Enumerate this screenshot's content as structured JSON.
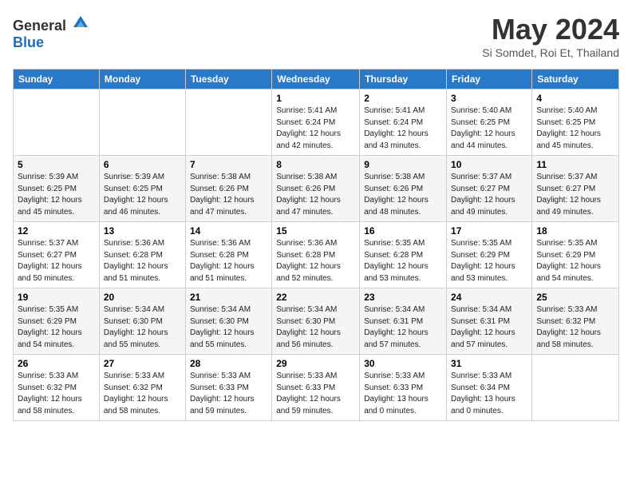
{
  "header": {
    "logo_general": "General",
    "logo_blue": "Blue",
    "month_title": "May 2024",
    "location": "Si Somdet, Roi Et, Thailand"
  },
  "weekdays": [
    "Sunday",
    "Monday",
    "Tuesday",
    "Wednesday",
    "Thursday",
    "Friday",
    "Saturday"
  ],
  "weeks": [
    [
      {
        "day": "",
        "info": ""
      },
      {
        "day": "",
        "info": ""
      },
      {
        "day": "",
        "info": ""
      },
      {
        "day": "1",
        "info": "Sunrise: 5:41 AM\nSunset: 6:24 PM\nDaylight: 12 hours\nand 42 minutes."
      },
      {
        "day": "2",
        "info": "Sunrise: 5:41 AM\nSunset: 6:24 PM\nDaylight: 12 hours\nand 43 minutes."
      },
      {
        "day": "3",
        "info": "Sunrise: 5:40 AM\nSunset: 6:25 PM\nDaylight: 12 hours\nand 44 minutes."
      },
      {
        "day": "4",
        "info": "Sunrise: 5:40 AM\nSunset: 6:25 PM\nDaylight: 12 hours\nand 45 minutes."
      }
    ],
    [
      {
        "day": "5",
        "info": "Sunrise: 5:39 AM\nSunset: 6:25 PM\nDaylight: 12 hours\nand 45 minutes."
      },
      {
        "day": "6",
        "info": "Sunrise: 5:39 AM\nSunset: 6:25 PM\nDaylight: 12 hours\nand 46 minutes."
      },
      {
        "day": "7",
        "info": "Sunrise: 5:38 AM\nSunset: 6:26 PM\nDaylight: 12 hours\nand 47 minutes."
      },
      {
        "day": "8",
        "info": "Sunrise: 5:38 AM\nSunset: 6:26 PM\nDaylight: 12 hours\nand 47 minutes."
      },
      {
        "day": "9",
        "info": "Sunrise: 5:38 AM\nSunset: 6:26 PM\nDaylight: 12 hours\nand 48 minutes."
      },
      {
        "day": "10",
        "info": "Sunrise: 5:37 AM\nSunset: 6:27 PM\nDaylight: 12 hours\nand 49 minutes."
      },
      {
        "day": "11",
        "info": "Sunrise: 5:37 AM\nSunset: 6:27 PM\nDaylight: 12 hours\nand 49 minutes."
      }
    ],
    [
      {
        "day": "12",
        "info": "Sunrise: 5:37 AM\nSunset: 6:27 PM\nDaylight: 12 hours\nand 50 minutes."
      },
      {
        "day": "13",
        "info": "Sunrise: 5:36 AM\nSunset: 6:28 PM\nDaylight: 12 hours\nand 51 minutes."
      },
      {
        "day": "14",
        "info": "Sunrise: 5:36 AM\nSunset: 6:28 PM\nDaylight: 12 hours\nand 51 minutes."
      },
      {
        "day": "15",
        "info": "Sunrise: 5:36 AM\nSunset: 6:28 PM\nDaylight: 12 hours\nand 52 minutes."
      },
      {
        "day": "16",
        "info": "Sunrise: 5:35 AM\nSunset: 6:28 PM\nDaylight: 12 hours\nand 53 minutes."
      },
      {
        "day": "17",
        "info": "Sunrise: 5:35 AM\nSunset: 6:29 PM\nDaylight: 12 hours\nand 53 minutes."
      },
      {
        "day": "18",
        "info": "Sunrise: 5:35 AM\nSunset: 6:29 PM\nDaylight: 12 hours\nand 54 minutes."
      }
    ],
    [
      {
        "day": "19",
        "info": "Sunrise: 5:35 AM\nSunset: 6:29 PM\nDaylight: 12 hours\nand 54 minutes."
      },
      {
        "day": "20",
        "info": "Sunrise: 5:34 AM\nSunset: 6:30 PM\nDaylight: 12 hours\nand 55 minutes."
      },
      {
        "day": "21",
        "info": "Sunrise: 5:34 AM\nSunset: 6:30 PM\nDaylight: 12 hours\nand 55 minutes."
      },
      {
        "day": "22",
        "info": "Sunrise: 5:34 AM\nSunset: 6:30 PM\nDaylight: 12 hours\nand 56 minutes."
      },
      {
        "day": "23",
        "info": "Sunrise: 5:34 AM\nSunset: 6:31 PM\nDaylight: 12 hours\nand 57 minutes."
      },
      {
        "day": "24",
        "info": "Sunrise: 5:34 AM\nSunset: 6:31 PM\nDaylight: 12 hours\nand 57 minutes."
      },
      {
        "day": "25",
        "info": "Sunrise: 5:33 AM\nSunset: 6:32 PM\nDaylight: 12 hours\nand 58 minutes."
      }
    ],
    [
      {
        "day": "26",
        "info": "Sunrise: 5:33 AM\nSunset: 6:32 PM\nDaylight: 12 hours\nand 58 minutes."
      },
      {
        "day": "27",
        "info": "Sunrise: 5:33 AM\nSunset: 6:32 PM\nDaylight: 12 hours\nand 58 minutes."
      },
      {
        "day": "28",
        "info": "Sunrise: 5:33 AM\nSunset: 6:33 PM\nDaylight: 12 hours\nand 59 minutes."
      },
      {
        "day": "29",
        "info": "Sunrise: 5:33 AM\nSunset: 6:33 PM\nDaylight: 12 hours\nand 59 minutes."
      },
      {
        "day": "30",
        "info": "Sunrise: 5:33 AM\nSunset: 6:33 PM\nDaylight: 13 hours\nand 0 minutes."
      },
      {
        "day": "31",
        "info": "Sunrise: 5:33 AM\nSunset: 6:34 PM\nDaylight: 13 hours\nand 0 minutes."
      },
      {
        "day": "",
        "info": ""
      }
    ]
  ]
}
